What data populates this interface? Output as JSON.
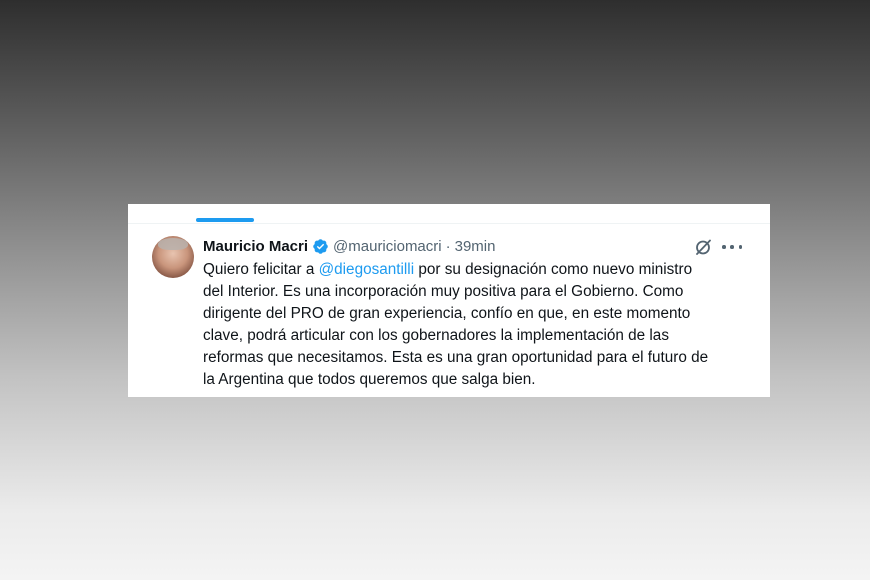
{
  "tweet": {
    "author_name": "Mauricio Macri",
    "handle": "@mauriciomacri",
    "separator": "·",
    "time": "39min",
    "text_before_mention": "Quiero felicitar a ",
    "mention": "@diegosantilli",
    "text_after_mention": " por su designación como nuevo ministro",
    "lines": [
      "del Interior. Es una incorporación muy positiva para el Gobierno. Como",
      "dirigente del PRO de gran experiencia, confío en que, en este momento",
      "clave, podrá articular con los gobernadores la implementación de las",
      "reformas que necesitamos. Esta es una gran oportunidad para el futuro de",
      "la Argentina que todos queremos que salga bien."
    ]
  },
  "icons": {
    "verified": "verified-badge-icon",
    "grok": "grok-icon",
    "more": "more-options-icon"
  },
  "colors": {
    "accent": "#1d9bf0",
    "text": "#0f1419",
    "muted": "#536471"
  }
}
